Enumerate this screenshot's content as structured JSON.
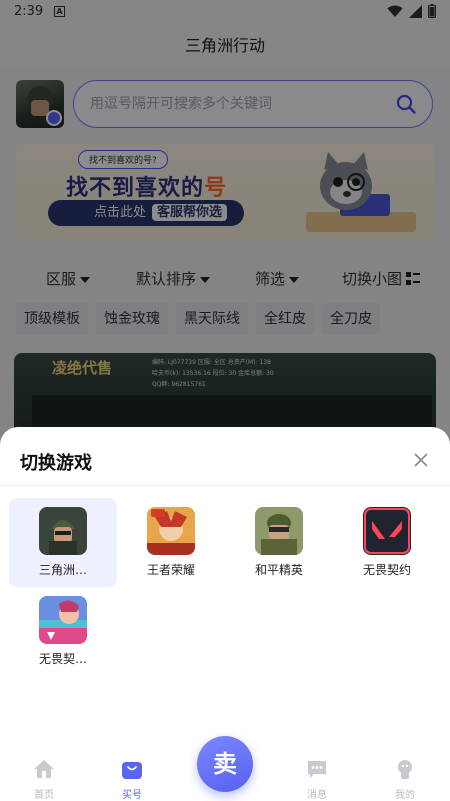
{
  "status_bar": {
    "time": "2:39",
    "notification_glyph": "A"
  },
  "header": {
    "title": "三角洲行动"
  },
  "search": {
    "placeholder": "用逗号隔开可搜索多个关键词"
  },
  "banner": {
    "small_prompt": "找不到喜欢的号?",
    "headline_main": "找不到喜欢的",
    "headline_accent": "号",
    "cta_text": "点击此处",
    "cta_highlight": "客服帮你选"
  },
  "filters": [
    {
      "label": "区服"
    },
    {
      "label": "默认排序"
    },
    {
      "label": "筛选"
    },
    {
      "label": "切换小图"
    }
  ],
  "tags": [
    "顶级模板",
    "蚀金玫瑰",
    "黑天际线",
    "全红皮",
    "全刀皮"
  ],
  "listing_preview": {
    "brand": "凌绝代售",
    "info_lines": [
      "编码: LJ077739  区服: 全区  总资产(M): 138",
      "哈夫币(k): 13536.16  段位: 30  金库总额: 30",
      "QQ群: 962815761"
    ]
  },
  "sheet": {
    "title": "切换游戏",
    "games": [
      {
        "name": "三角洲…",
        "icon": "delta-force-icon",
        "selected": true
      },
      {
        "name": "王者荣耀",
        "icon": "honor-of-kings-icon",
        "selected": false
      },
      {
        "name": "和平精英",
        "icon": "peacekeeper-elite-icon",
        "selected": false
      },
      {
        "name": "无畏契约",
        "icon": "valorant-icon",
        "selected": false
      },
      {
        "name": "无畏契…",
        "icon": "valorant-mobile-icon",
        "selected": false
      }
    ]
  },
  "tab_bar": {
    "tabs": [
      {
        "label": "首页",
        "icon": "home-icon",
        "active": false
      },
      {
        "label": "买号",
        "icon": "bag-icon",
        "active": true
      },
      {
        "label": "消息",
        "icon": "message-icon",
        "active": false
      },
      {
        "label": "我的",
        "icon": "profile-icon",
        "active": false
      }
    ],
    "sell_label": "卖"
  },
  "colors": {
    "accent": "#5865f2",
    "overlay": "rgba(0,0,0,0.45)"
  }
}
